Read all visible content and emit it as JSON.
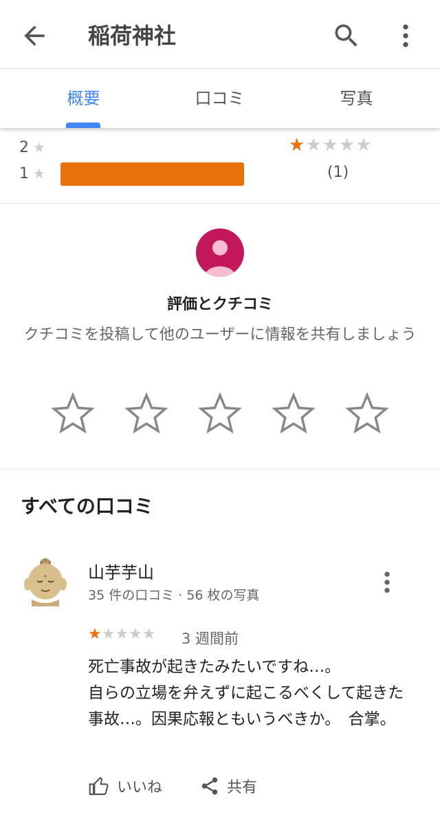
{
  "header": {
    "title": "稲荷神社",
    "back_icon": "arrow-back-icon",
    "search_icon": "search-icon",
    "more_icon": "more-vert-icon"
  },
  "tabs": [
    {
      "label": "概要",
      "active": true
    },
    {
      "label": "口コミ"
    },
    {
      "label": "写真"
    }
  ],
  "rating_summary": {
    "rows": [
      {
        "label": "2"
      },
      {
        "label": "1",
        "fraction": 1.0
      }
    ],
    "star_char": "★",
    "average_stars": 1,
    "review_count": "(1)",
    "accent": "#e8710a"
  },
  "rate_prompt": {
    "heading": "評価とクチコミ",
    "subtext": "クチコミを投稿して他のユーザーに情報を共有しましょう",
    "avatar_color": "#c2185b",
    "star_count": 5
  },
  "reviews": {
    "heading": "すべての口コミ",
    "items": [
      {
        "author": "山芋芋山",
        "meta": "35 件の口コミ · 56 枚の写真",
        "rating": 1,
        "date": "3 週間前",
        "text": "死亡事故が起きたみたいですね…。\n自らの立場を弁えずに起こるべくして起きた事故…。因果応報ともいうべきか。　合掌。",
        "like_label": "いいね",
        "share_label": "共有"
      }
    ]
  }
}
